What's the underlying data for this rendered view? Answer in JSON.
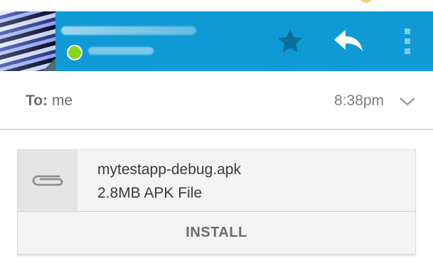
{
  "header": {
    "actions": [
      {
        "name": "star",
        "icon": "star-icon"
      },
      {
        "name": "reply",
        "icon": "reply-icon"
      },
      {
        "name": "more",
        "icon": "more-vert-icon"
      }
    ],
    "colors": {
      "bar": "#0f9ad6",
      "status": "#8fd21a"
    }
  },
  "message": {
    "to_label": "To:",
    "to_value": "me",
    "time": "8:38pm",
    "expand_icon": "chevron-down-icon"
  },
  "attachment": {
    "icon": "paperclip-icon",
    "file_name": "mytestapp-debug.apk",
    "file_meta": "2.8MB APK File",
    "action_label": "INSTALL"
  }
}
